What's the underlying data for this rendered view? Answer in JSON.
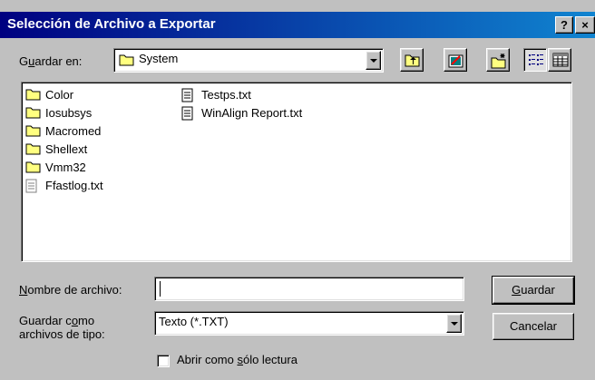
{
  "window": {
    "title": "Selección de Archivo a Exportar",
    "help_label": "?",
    "close_label": "×"
  },
  "save_in": {
    "label_pre": "G",
    "label_u": "u",
    "label_post": "ardar en:",
    "value": "System"
  },
  "toolbar": {
    "icons": [
      "up-folder-icon",
      "desktop-icon",
      "new-folder-icon",
      "list-view-icon",
      "details-view-icon"
    ]
  },
  "files": {
    "col1": [
      {
        "name": "Color",
        "type": "folder"
      },
      {
        "name": "Iosubsys",
        "type": "folder"
      },
      {
        "name": "Macromed",
        "type": "folder"
      },
      {
        "name": "Shellext",
        "type": "folder"
      },
      {
        "name": "Vmm32",
        "type": "folder"
      },
      {
        "name": "Ffastlog.txt",
        "type": "file"
      }
    ],
    "col2": [
      {
        "name": "Testps.txt",
        "type": "file"
      },
      {
        "name": "WinAlign Report.txt",
        "type": "file"
      }
    ]
  },
  "filename": {
    "label_u": "N",
    "label_post": "ombre de archivo:",
    "value": ""
  },
  "filetype": {
    "label_line1_pre": "Guardar c",
    "label_line1_u": "o",
    "label_line1_post": "mo",
    "label_line2": "archivos de tipo:",
    "value": "Texto (*.TXT)"
  },
  "readonly": {
    "label_pre": "Abrir como ",
    "label_u": "s",
    "label_post": "ólo lectura",
    "checked": false
  },
  "buttons": {
    "save_u": "G",
    "save_post": "uardar",
    "cancel": "Cancelar"
  }
}
